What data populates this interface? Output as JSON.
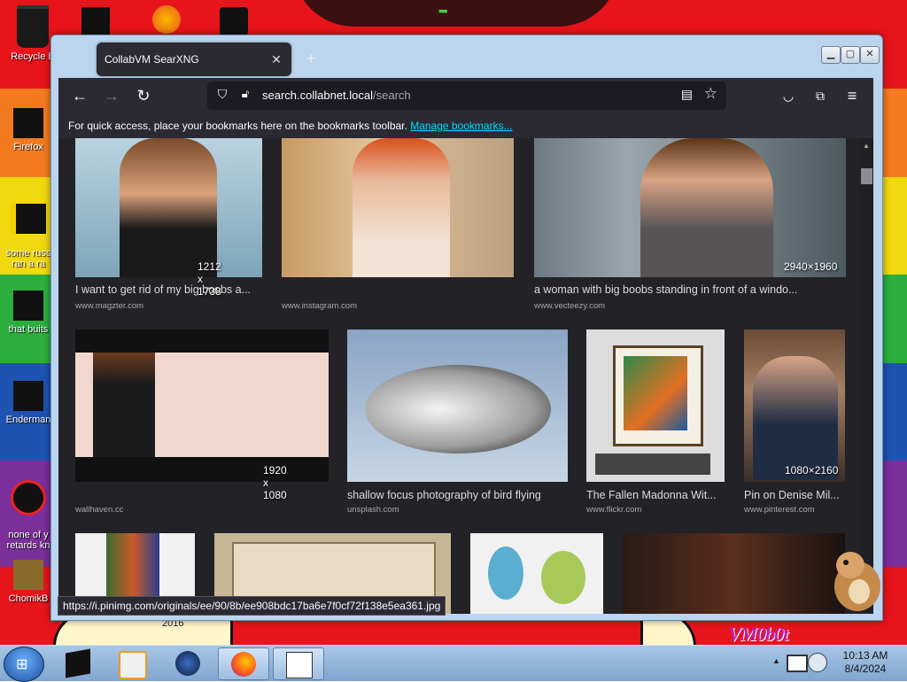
{
  "desktop": {
    "icons": [
      {
        "label": "Recycle B",
        "name": "recycle-bin"
      },
      {
        "label": "Firefox",
        "name": "firefox"
      },
      {
        "label": "some russ\nran a ra",
        "name": "desktop-file-1"
      },
      {
        "label": "that buits",
        "name": "desktop-file-2"
      },
      {
        "label": "Enderman",
        "name": "enderman"
      },
      {
        "label": "none of y\nretards kn",
        "name": "desktop-file-3"
      },
      {
        "label": "ChomikB",
        "name": "chomikb"
      }
    ],
    "watermark": "VM0b0t",
    "under_text": "2016"
  },
  "browser": {
    "tab_title": "CollabVM SearXNG",
    "url_host": "search.collabnet.local",
    "url_path": "/search",
    "bookmarks_text": "For quick access, place your bookmarks here on the bookmarks toolbar.",
    "bookmarks_link": "Manage bookmarks...",
    "status_url": "https://i.pinimg.com/originals/ee/90/8b/ee908bdc17ba6e7f0cf72f138e5ea361.jpg"
  },
  "results": [
    {
      "caption": "I want to get rid of my big boobs a...",
      "source": "www.magzter.com",
      "dims": "1212 x 1738"
    },
    {
      "caption": "",
      "source": "www.instagram.com",
      "dims": ""
    },
    {
      "caption": "a woman with big boobs standing in front of a windo...",
      "source": "www.vecteezy.com",
      "dims": "2940×1960"
    },
    {
      "caption": "",
      "source": "wallhaven.cc",
      "dims": "1920 x 1080"
    },
    {
      "caption": "shallow focus photography of bird flying",
      "source": "unsplash.com",
      "dims": ""
    },
    {
      "caption": "The Fallen Madonna Wit...",
      "source": "www.flickr.com",
      "dims": ""
    },
    {
      "caption": "Pin on Denise Mil...",
      "source": "www.pinterest.com",
      "dims": "1080×2160"
    }
  ],
  "taskbar": {
    "time": "10:13 AM",
    "date": "8/4/2024"
  },
  "colors": {
    "browser_chrome": "#2b2a33",
    "content_bg": "#222227",
    "link": "#00ddff",
    "taskbar": "#a9c6e6"
  }
}
